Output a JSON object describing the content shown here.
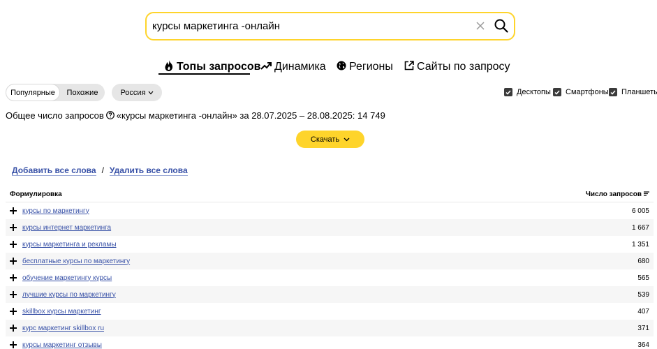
{
  "search": {
    "value": "курсы маркетинга -онлайн"
  },
  "tabs": [
    {
      "label": "Топы запросов",
      "icon": "fire-icon",
      "active": true
    },
    {
      "label": "Динамика",
      "icon": "trend-icon"
    },
    {
      "label": "Регионы",
      "icon": "globe-icon"
    },
    {
      "label": "Сайты по запросу",
      "icon": "external-link-icon"
    }
  ],
  "filters": {
    "segment": [
      "Популярные",
      "Похожие"
    ],
    "region": "Россия",
    "devices": [
      "Десктопы",
      "Смартфоны",
      "Планшеты"
    ]
  },
  "summary": {
    "label": "Общее число запросов",
    "query": "«курсы маркетинга -онлайн» за 28.07.2025 – 28.08.2025: 14 749"
  },
  "download_label": "Скачать",
  "links": {
    "add": "Добавить все слова",
    "separator": "/",
    "remove": "Удалить все слова"
  },
  "table": {
    "headers": {
      "phrase": "Формулировка",
      "count": "Число запросов"
    },
    "rows": [
      {
        "phrase": "курсы по маркетингу",
        "count": "6 005"
      },
      {
        "phrase": "курсы интернет маркетинга",
        "count": "1 667"
      },
      {
        "phrase": "курсы маркетинга и рекламы",
        "count": "1 351"
      },
      {
        "phrase": "бесплатные курсы по маркетингу",
        "count": "680"
      },
      {
        "phrase": "обучение маркетингу курсы",
        "count": "565"
      },
      {
        "phrase": "лучшие курсы по маркетингу",
        "count": "539"
      },
      {
        "phrase": "skillbox курсы маркетинг",
        "count": "407"
      },
      {
        "phrase": "курс маркетинг skillbox ru",
        "count": "371"
      },
      {
        "phrase": "курсы маркетинг отзывы",
        "count": "364"
      }
    ]
  },
  "colors": {
    "accent": "#fed42b",
    "link": "#3851a7",
    "checkbox": "#3b3b3b"
  }
}
